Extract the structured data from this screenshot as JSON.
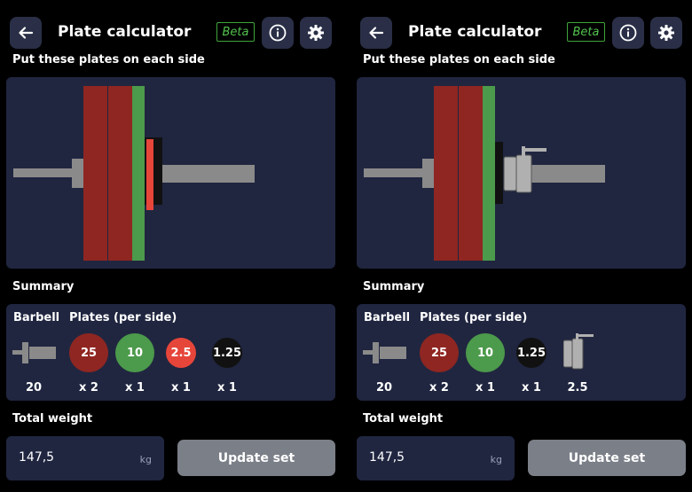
{
  "colors": {
    "background": "#000000",
    "card": "#202640",
    "button": "#2a2f47",
    "beta": "#53c24d",
    "plate25": "#8f2621",
    "plate10": "#4c9a4b",
    "plate2_5": "#e6453a",
    "plate1_25": "#111111",
    "bar": "#8a8a8a",
    "update": "#7b7f88"
  },
  "panels": [
    {
      "header": {
        "title": "Plate calculator",
        "beta_label": "Beta",
        "back_icon": "arrow-left-icon",
        "info_icon": "info-icon",
        "settings_icon": "gear-icon"
      },
      "instruction": "Put these plates on each side",
      "summary_label": "Summary",
      "summary": {
        "barbell_label": "Barbell",
        "plates_label": "Plates (per side)",
        "barbell_weight": "20",
        "plates": [
          {
            "weight": "25",
            "count": "x 2"
          },
          {
            "weight": "10",
            "count": "x 1"
          },
          {
            "weight": "2.5",
            "count": "x 1"
          },
          {
            "weight": "1.25",
            "count": "x 1"
          }
        ]
      },
      "total_label": "Total weight",
      "total_value": "147,5",
      "unit": "kg",
      "update_label": "Update set"
    },
    {
      "header": {
        "title": "Plate calculator",
        "beta_label": "Beta",
        "back_icon": "arrow-left-icon",
        "info_icon": "info-icon",
        "settings_icon": "gear-icon"
      },
      "instruction": "Put these plates on each side",
      "summary_label": "Summary",
      "summary": {
        "barbell_label": "Barbell",
        "plates_label": "Plates (per side)",
        "barbell_weight": "20",
        "plates": [
          {
            "weight": "25",
            "count": "x 2"
          },
          {
            "weight": "10",
            "count": "x 1"
          },
          {
            "weight": "1.25",
            "count": "x 1"
          }
        ],
        "collar_weight": "2.5"
      },
      "total_label": "Total weight",
      "total_value": "147,5",
      "unit": "kg",
      "update_label": "Update set"
    }
  ]
}
